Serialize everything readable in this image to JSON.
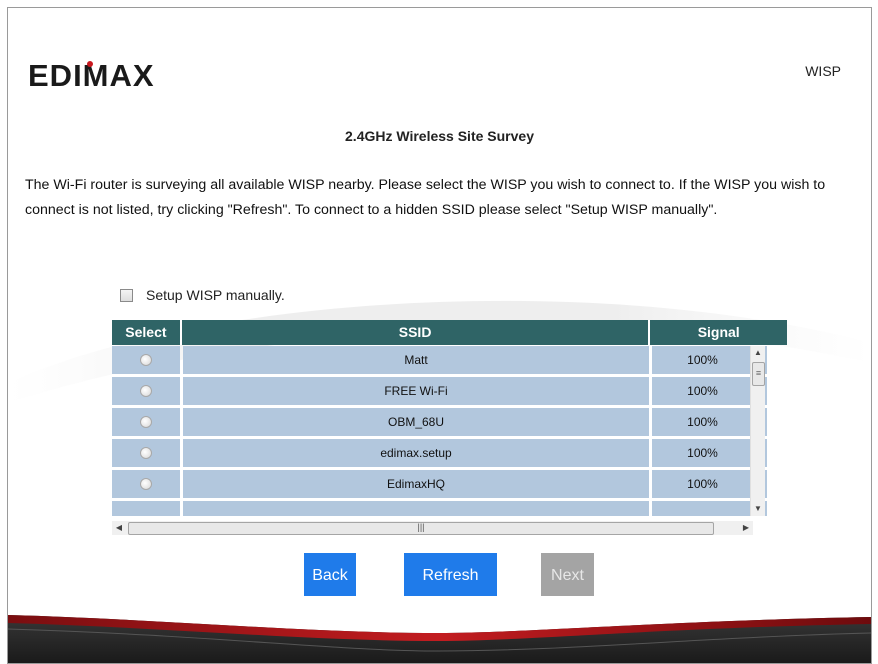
{
  "header": {
    "logo_text": "EDIMAX",
    "mode": "WISP"
  },
  "page": {
    "title": "2.4GHz Wireless Site Survey",
    "description": "The Wi-Fi router is surveying all available WISP nearby. Please select the WISP you wish to connect to. If the WISP you wish to connect is not listed, try clicking \"Refresh\". To connect to a hidden SSID please select \"Setup WISP manually\"."
  },
  "manual": {
    "label": "Setup WISP manually."
  },
  "table": {
    "headers": [
      "Select",
      "SSID",
      "Signal"
    ],
    "rows": [
      {
        "ssid": "Matt",
        "signal": "100%"
      },
      {
        "ssid": "FREE Wi-Fi",
        "signal": "100%"
      },
      {
        "ssid": "OBM_68U",
        "signal": "100%"
      },
      {
        "ssid": "edimax.setup",
        "signal": "100%"
      },
      {
        "ssid": "EdimaxHQ",
        "signal": "100%"
      }
    ]
  },
  "buttons": {
    "back": "Back",
    "refresh": "Refresh",
    "next": "Next"
  },
  "colors": {
    "header_bg": "#2f6466",
    "row_bg": "#b2c7dd",
    "button_active": "#1f7bea",
    "button_disabled": "#a4a4a4",
    "footer_red": "#a4171b"
  }
}
